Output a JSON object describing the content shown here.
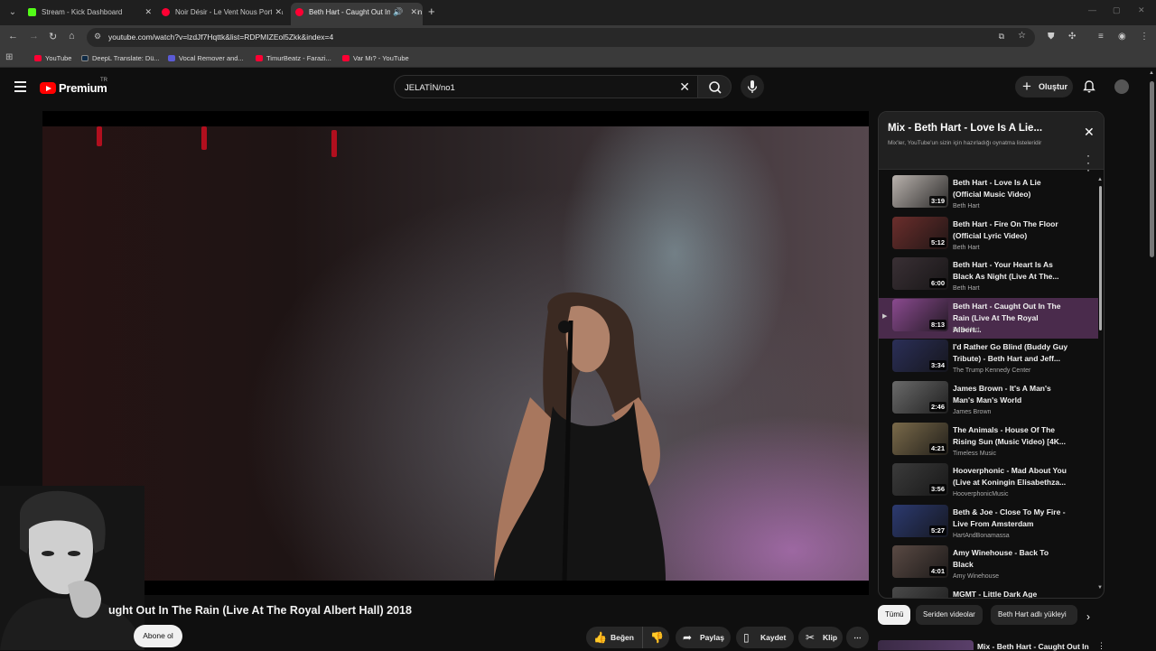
{
  "browser": {
    "tabs": [
      {
        "title": "Stream - Kick Dashboard",
        "favicon": "kick-icon",
        "color": "#53fc18",
        "active": false
      },
      {
        "title": "Noir Désir - Le Vent Nous Portera",
        "favicon": "youtube-icon",
        "color": "#ff0033",
        "active": false
      },
      {
        "title": "Beth Hart - Caught Out In The Rain",
        "favicon": "youtube-icon",
        "color": "#ff0033",
        "active": true
      }
    ],
    "url": "youtube.com/watch?v=lzdJf7Hqttk&list=RDPMIZEol5Zkk&index=4",
    "bookmarks": [
      {
        "label": "YouTube",
        "color": "#ff0033"
      },
      {
        "label": "DeepL Translate: Dü...",
        "color": "#0f2b46"
      },
      {
        "label": "Vocal Remover and...",
        "color": "#5b5bd6"
      },
      {
        "label": "TimurBeatz - Farazi...",
        "color": "#ff0033"
      },
      {
        "label": "Var Mı? - YouTube",
        "color": "#ff0033"
      }
    ]
  },
  "header": {
    "logo_text": "Premium",
    "region": "TR",
    "search_value": "JELATİN/no1",
    "create_label": "Oluştur"
  },
  "video": {
    "title": "ught Out In The Rain (Live At The Royal Albert Hall) 2018",
    "subscribe_label": "Abone ol",
    "actions": {
      "like": "Beğen",
      "share": "Paylaş",
      "save": "Kaydet",
      "clip": "Klip"
    }
  },
  "playlist": {
    "title": "Mix - Beth Hart - Love Is A Lie...",
    "subtitle": "Mix'ler, YouTube'un sizin için hazırladığı oynatma listeleridir",
    "items": [
      {
        "title": "Beth Hart - Love Is A Lie (Official Music Video)",
        "channel": "Beth Hart",
        "duration": "3:19",
        "thumb": "#b9b2ad",
        "current": false
      },
      {
        "title": "Beth Hart - Fire On The Floor (Official Lyric Video)",
        "channel": "Beth Hart",
        "duration": "5:12",
        "thumb": "#6b2e2c",
        "current": false
      },
      {
        "title": "Beth Hart - Your Heart Is As Black As Night (Live At The...",
        "channel": "Beth Hart",
        "duration": "6:00",
        "thumb": "#3a3035",
        "current": false
      },
      {
        "title": "Beth Hart - Caught Out In The Rain (Live At The Royal Albert...",
        "channel": "Beth Hart",
        "duration": "8:13",
        "thumb": "#8a4a8f",
        "current": true
      },
      {
        "title": "I'd Rather Go Blind (Buddy Guy Tribute) - Beth Hart and Jeff...",
        "channel": "The Trump Kennedy Center",
        "duration": "3:34",
        "thumb": "#2b2f58",
        "current": false
      },
      {
        "title": "James Brown - It's A Man's Man's Man's World",
        "channel": "James Brown",
        "duration": "2:46",
        "thumb": "#6a6a6a",
        "current": false
      },
      {
        "title": "The Animals - House Of The Rising Sun (Music Video) [4K...",
        "channel": "Timeless Music",
        "duration": "4:21",
        "thumb": "#7a6a4a",
        "current": false
      },
      {
        "title": "Hooverphonic - Mad About You (Live at Koningin Elisabethza...",
        "channel": "HooverphonicMusic",
        "duration": "3:56",
        "thumb": "#3b3b3b",
        "current": false
      },
      {
        "title": "Beth & Joe - Close To My Fire - Live From Amsterdam",
        "channel": "HartAndBonamassa",
        "duration": "5:27",
        "thumb": "#2c3a70",
        "current": false
      },
      {
        "title": "Amy Winehouse - Back To Black",
        "channel": "Amy Winehouse",
        "duration": "4:01",
        "thumb": "#5a4a44",
        "current": false
      },
      {
        "title": "MGMT - Little Dark Age",
        "channel": "",
        "duration": "",
        "thumb": "#4a4a4a",
        "current": false
      }
    ],
    "chips": [
      {
        "label": "Tümü",
        "selected": true
      },
      {
        "label": "Seriden videolar",
        "selected": false
      },
      {
        "label": "Beth Hart adlı yükleyi",
        "selected": false
      }
    ],
    "next_up_title": "Mix - Beth Hart - Caught Out In"
  },
  "colors": {
    "brand": "#ff0000",
    "background": "#0f0f0f",
    "current_item": "#4a2b4c"
  }
}
